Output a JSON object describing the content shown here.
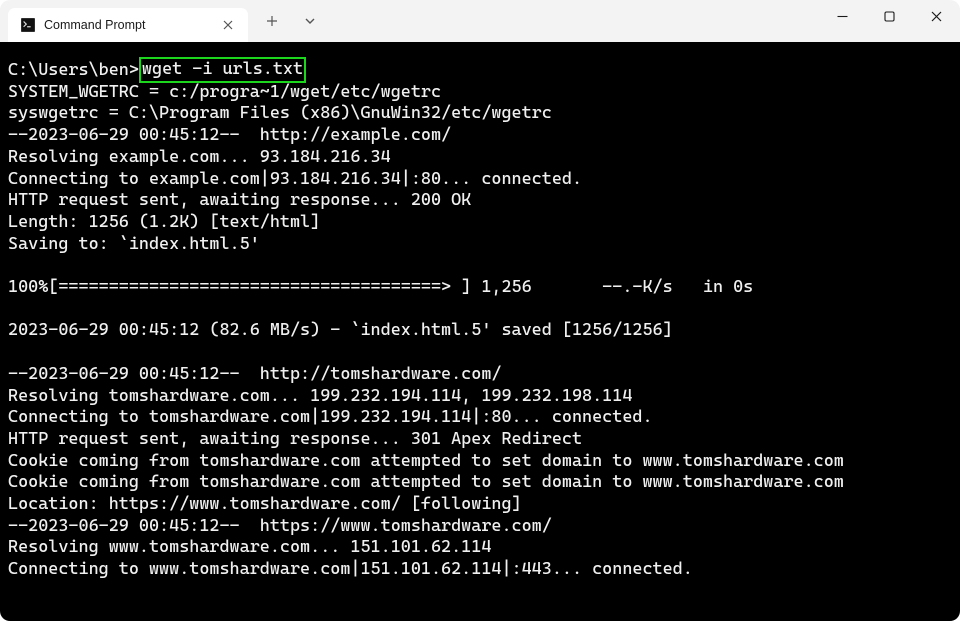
{
  "window": {
    "tab_title": "Command Prompt"
  },
  "terminal": {
    "prompt": "C:\\Users\\ben>",
    "command": "wget -i urls.txt",
    "lines": [
      "SYSTEM_WGETRC = c:/progra~1/wget/etc/wgetrc",
      "syswgetrc = C:\\Program Files (x86)\\GnuWin32/etc/wgetrc",
      "--2023-06-29 00:45:12--  http://example.com/",
      "Resolving example.com... 93.184.216.34",
      "Connecting to example.com|93.184.216.34|:80... connected.",
      "HTTP request sent, awaiting response... 200 OK",
      "Length: 1256 (1.2K) [text/html]",
      "Saving to: `index.html.5'",
      "",
      "100%[======================================> ] 1,256       --.-K/s   in 0s",
      "",
      "2023-06-29 00:45:12 (82.6 MB/s) - `index.html.5' saved [1256/1256]",
      "",
      "--2023-06-29 00:45:12--  http://tomshardware.com/",
      "Resolving tomshardware.com... 199.232.194.114, 199.232.198.114",
      "Connecting to tomshardware.com|199.232.194.114|:80... connected.",
      "HTTP request sent, awaiting response... 301 Apex Redirect",
      "Cookie coming from tomshardware.com attempted to set domain to www.tomshardware.com",
      "Cookie coming from tomshardware.com attempted to set domain to www.tomshardware.com",
      "Location: https://www.tomshardware.com/ [following]",
      "--2023-06-29 00:45:12--  https://www.tomshardware.com/",
      "Resolving www.tomshardware.com... 151.101.62.114",
      "Connecting to www.tomshardware.com|151.101.62.114|:443... connected."
    ]
  }
}
